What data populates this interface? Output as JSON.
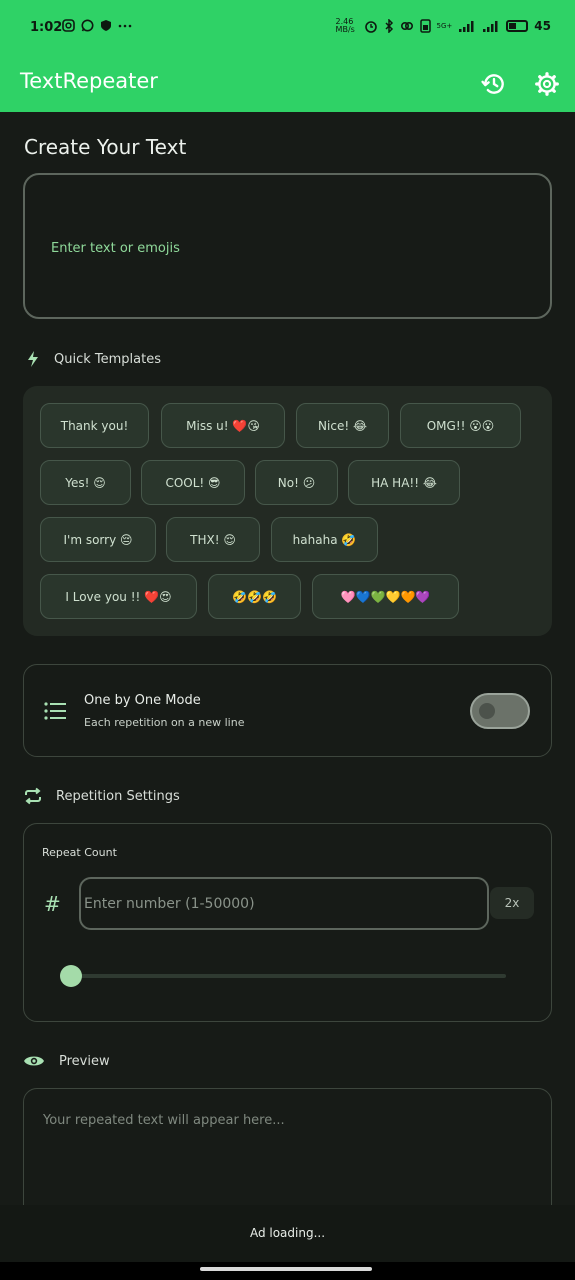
{
  "status_bar": {
    "time": "1:02",
    "left_icons": [
      "instagram-icon",
      "whatsapp-icon",
      "shield-icon",
      "more-icon"
    ],
    "net_speed": "2.46 MB/s",
    "network": "5G+",
    "battery": "45",
    "battery_level": 0.45
  },
  "app_bar": {
    "title": "TextRepeater",
    "icons": [
      "history-icon",
      "settings-icon"
    ]
  },
  "create": {
    "heading": "Create Your Text",
    "placeholder": "Enter text or emojis"
  },
  "templates": {
    "heading": "Quick Templates",
    "chips": [
      "Thank you!",
      "Miss u! ❤️😘",
      "Nice! 😂",
      "OMG!! 😮😮",
      "Yes! 😌",
      "COOL! 😎",
      "No! 😕",
      "HA HA!! 😂",
      "I'm sorry 😔",
      "THX! 😌",
      "hahaha 🤣",
      "I Love you !! ❤️😍",
      "🤣🤣🤣",
      "🩷💙💚💛🧡💜"
    ]
  },
  "mode": {
    "title": "One by One Mode",
    "subtitle": "Each repetition on a new line",
    "enabled": false
  },
  "repetition": {
    "heading": "Repetition Settings",
    "label": "Repeat Count",
    "placeholder": "Enter number (1-50000)",
    "multiplier": "2x",
    "slider_value": 0
  },
  "preview": {
    "heading": "Preview",
    "placeholder": "Your repeated text will appear here..."
  },
  "ad": {
    "text": "Ad loading..."
  },
  "colors": {
    "accent": "#2fd266",
    "background": "#171b17",
    "card": "#232a23",
    "chip": "#2a362c",
    "hint_green": "#8fd99a"
  }
}
